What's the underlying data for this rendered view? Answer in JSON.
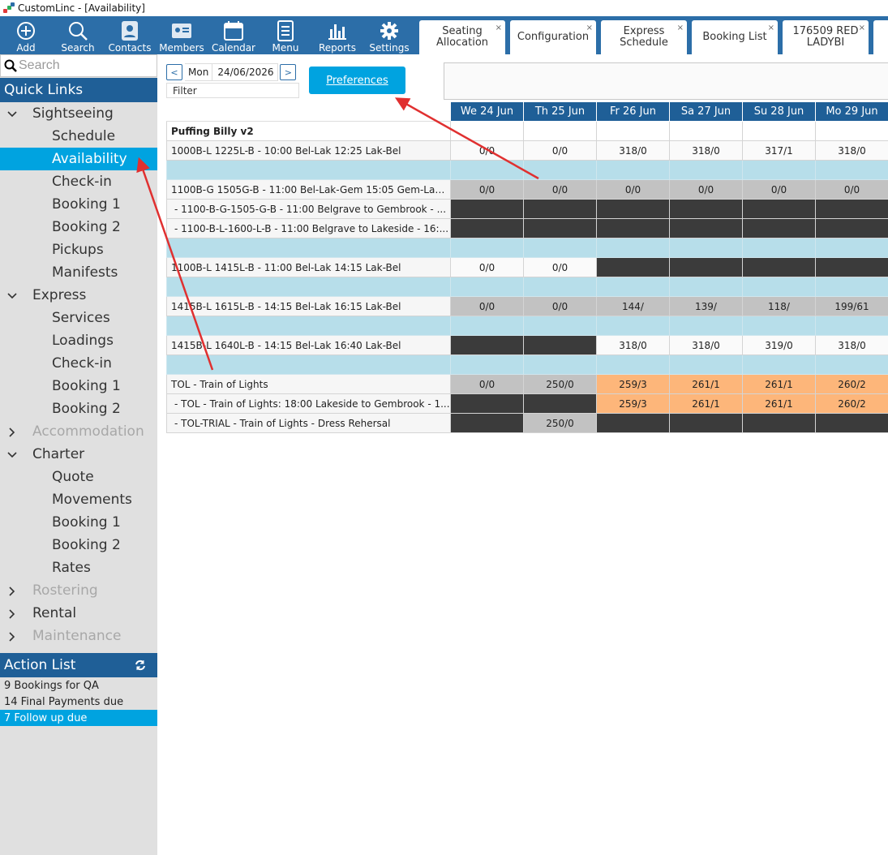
{
  "window": {
    "title": "CustomLinc - [Availability]"
  },
  "toolbar": {
    "buttons": [
      {
        "label": "Add",
        "icon": "add-icon"
      },
      {
        "label": "Search",
        "icon": "search-icon"
      },
      {
        "label": "Contacts",
        "icon": "contacts-icon"
      },
      {
        "label": "Members",
        "icon": "members-icon"
      },
      {
        "label": "Calendar",
        "icon": "calendar-icon"
      },
      {
        "label": "Menu",
        "icon": "menu-icon"
      },
      {
        "label": "Reports",
        "icon": "reports-icon"
      },
      {
        "label": "Settings",
        "icon": "gear-icon"
      }
    ],
    "tabs": [
      {
        "label": "Seating\nAllocation"
      },
      {
        "label": "Configuration"
      },
      {
        "label": "Express\nSchedule"
      },
      {
        "label": "Booking List"
      },
      {
        "label": "176509 RED\nLADYBI"
      }
    ],
    "tab_close": "×"
  },
  "sidebar": {
    "search_placeholder": "Search",
    "quick_links_title": "Quick Links",
    "groups": [
      {
        "label": "Sightseeing",
        "expanded": true,
        "items": [
          "Schedule",
          "Availability",
          "Check-in",
          "Booking 1",
          "Booking 2",
          "Pickups",
          "Manifests"
        ]
      },
      {
        "label": "Express",
        "expanded": true,
        "items": [
          "Services",
          "Loadings",
          "Check-in",
          "Booking 1",
          "Booking 2"
        ]
      },
      {
        "label": "Accommodation",
        "expanded": false,
        "disabled": true,
        "items": []
      },
      {
        "label": "Charter",
        "expanded": true,
        "items": [
          "Quote",
          "Movements",
          "Booking 1",
          "Booking 2",
          "Rates"
        ]
      },
      {
        "label": "Rostering",
        "expanded": false,
        "disabled": true,
        "items": []
      },
      {
        "label": "Rental",
        "expanded": false,
        "items": []
      },
      {
        "label": "Maintenance",
        "expanded": false,
        "disabled": true,
        "items": []
      }
    ],
    "active_item": "Availability",
    "action_list_title": "Action List",
    "action_items": [
      "9 Bookings for QA",
      "14 Final Payments due",
      "7 Follow up due"
    ],
    "active_action": 2
  },
  "main": {
    "prev": "<",
    "next": ">",
    "day_of_week": "Mon",
    "date": "24/06/2026",
    "filter_label": "Filter",
    "preferences_label": "Preferences",
    "columns": [
      "We 24 Jun",
      "Th 25 Jun",
      "Fr 26 Jun",
      "Sa 27 Jun",
      "Su 28 Jun",
      "Mo 29 Jun"
    ],
    "rows": [
      {
        "type": "title",
        "name": "Puffing Billy v2"
      },
      {
        "type": "data",
        "name": "1000B-L 1225L-B - 10:00 Bel-Lak 12:25 Lak-Bel",
        "cells": [
          [
            "0/0",
            "w"
          ],
          [
            "0/0",
            "w"
          ],
          [
            "318/0",
            "w"
          ],
          [
            "318/0",
            "w"
          ],
          [
            "317/1",
            "w"
          ],
          [
            "318/0",
            "w"
          ]
        ]
      },
      {
        "type": "sep"
      },
      {
        "type": "data",
        "name": "1100B-G 1505G-B - 11:00 Bel-Lak-Gem 15:05 Gem-Lak-...",
        "cells": [
          [
            "0/0",
            "g"
          ],
          [
            "0/0",
            "g"
          ],
          [
            "0/0",
            "g"
          ],
          [
            "0/0",
            "g"
          ],
          [
            "0/0",
            "g"
          ],
          [
            "0/0",
            "g"
          ]
        ]
      },
      {
        "type": "data",
        "sub": true,
        "name": "- 1100-B-G-1505-G-B - 11:00 Belgrave to Gembrook - ...",
        "cells": [
          [
            "",
            "d"
          ],
          [
            "",
            "d"
          ],
          [
            "",
            "d"
          ],
          [
            "",
            "d"
          ],
          [
            "",
            "d"
          ],
          [
            "",
            "d"
          ]
        ]
      },
      {
        "type": "data",
        "sub": true,
        "name": "- 1100-B-L-1600-L-B - 11:00 Belgrave to Lakeside - 16:...",
        "cells": [
          [
            "",
            "d"
          ],
          [
            "",
            "d"
          ],
          [
            "",
            "d"
          ],
          [
            "",
            "d"
          ],
          [
            "",
            "d"
          ],
          [
            "",
            "d"
          ]
        ]
      },
      {
        "type": "sep"
      },
      {
        "type": "data",
        "name": "1100B-L 1415L-B - 11:00 Bel-Lak 14:15 Lak-Bel",
        "cells": [
          [
            "0/0",
            "w"
          ],
          [
            "0/0",
            "w"
          ],
          [
            "",
            "d"
          ],
          [
            "",
            "d"
          ],
          [
            "",
            "d"
          ],
          [
            "",
            "d"
          ]
        ]
      },
      {
        "type": "sep"
      },
      {
        "type": "data",
        "name": "1415B-L 1615L-B - 14:15 Bel-Lak 16:15 Lak-Bel",
        "cells": [
          [
            "0/0",
            "g"
          ],
          [
            "0/0",
            "g"
          ],
          [
            "144/",
            "g"
          ],
          [
            "139/",
            "g"
          ],
          [
            "118/",
            "g"
          ],
          [
            "199/61",
            "g"
          ]
        ]
      },
      {
        "type": "sep"
      },
      {
        "type": "data",
        "name": "1415B-L 1640L-B - 14:15 Bel-Lak 16:40 Lak-Bel",
        "cells": [
          [
            "",
            "d"
          ],
          [
            "",
            "d"
          ],
          [
            "318/0",
            "w"
          ],
          [
            "318/0",
            "w"
          ],
          [
            "319/0",
            "w"
          ],
          [
            "318/0",
            "w"
          ]
        ]
      },
      {
        "type": "sep"
      },
      {
        "type": "data",
        "name": "TOL - Train of Lights",
        "cells": [
          [
            "0/0",
            "g"
          ],
          [
            "250/0",
            "g"
          ],
          [
            "259/3",
            "o"
          ],
          [
            "261/1",
            "o"
          ],
          [
            "261/1",
            "o"
          ],
          [
            "260/2",
            "o"
          ]
        ]
      },
      {
        "type": "data",
        "sub": true,
        "name": "- TOL - Train of Lights: 18:00 Lakeside to Gembrook - 1...",
        "cells": [
          [
            "",
            "d"
          ],
          [
            "",
            "d"
          ],
          [
            "259/3",
            "o"
          ],
          [
            "261/1",
            "o"
          ],
          [
            "261/1",
            "o"
          ],
          [
            "260/2",
            "o"
          ]
        ]
      },
      {
        "type": "data",
        "sub": true,
        "name": "- TOL-TRIAL - Train of Lights - Dress Rehersal",
        "cells": [
          [
            "",
            "d"
          ],
          [
            "250/0",
            "g"
          ],
          [
            "",
            "d"
          ],
          [
            "",
            "d"
          ],
          [
            "",
            "d"
          ],
          [
            "",
            "d"
          ]
        ]
      }
    ]
  },
  "colors": {
    "toolbar": "#2c6ea8",
    "header": "#1f5f97",
    "accent": "#00a3e0",
    "separator": "#b7deea",
    "available_grey": "#c2c2c2",
    "unavailable": "#3b3b3b",
    "warning_orange": "#fdb67a",
    "annotation_arrow": "#e03030"
  }
}
